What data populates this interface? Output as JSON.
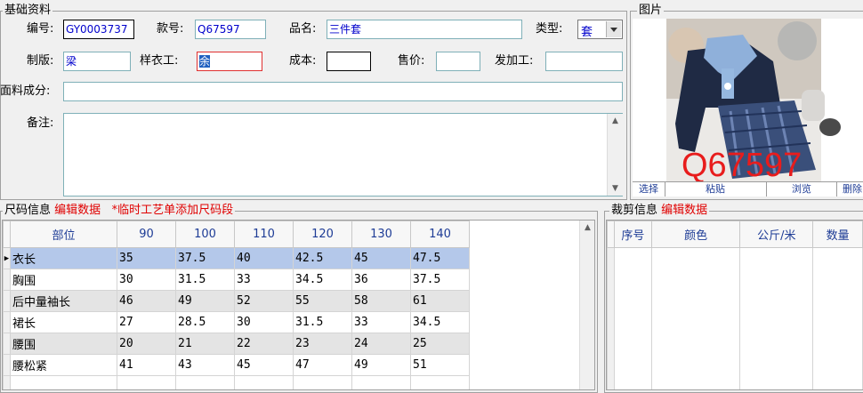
{
  "basic": {
    "title": "基础资料",
    "code_label": "编号:",
    "code_value": "GY0003737",
    "style_label": "款号:",
    "style_value": "Q67597",
    "name_label": "品名:",
    "name_value": "三件套",
    "type_label": "类型:",
    "type_value": "套",
    "maker_label": "制版:",
    "maker_value": "梁",
    "sample_label": "样衣工:",
    "sample_value": "余",
    "cost_label": "成本:",
    "cost_value": "",
    "price_label": "售价:",
    "price_value": "",
    "outsource_label": "发加工:",
    "outsource_value": "",
    "fabric_label": "面料成分:",
    "fabric_value": "",
    "note_label": "备注:",
    "note_value": ""
  },
  "picture": {
    "title": "图片",
    "watermark": "Q67597",
    "buttons": [
      "选择",
      "粘贴",
      "浏览",
      "删除"
    ]
  },
  "size": {
    "title": "尺码信息",
    "edit_link": "编辑数据",
    "hint": "*临时工艺单添加尺码段",
    "headers": [
      "部位",
      "90",
      "100",
      "110",
      "120",
      "130",
      "140"
    ],
    "rows": [
      [
        "衣长",
        "35",
        "37.5",
        "40",
        "42.5",
        "45",
        "47.5"
      ],
      [
        "胸围",
        "30",
        "31.5",
        "33",
        "34.5",
        "36",
        "37.5"
      ],
      [
        "后中量袖长",
        "46",
        "49",
        "52",
        "55",
        "58",
        "61"
      ],
      [
        "裙长",
        "27",
        "28.5",
        "30",
        "31.5",
        "33",
        "34.5"
      ],
      [
        "腰围",
        "20",
        "21",
        "22",
        "23",
        "24",
        "25"
      ],
      [
        "腰松紧",
        "41",
        "43",
        "45",
        "47",
        "49",
        "51"
      ]
    ],
    "selected_row": 0
  },
  "cutting": {
    "title": "裁剪信息",
    "edit_link": "编辑数据",
    "headers": [
      "序号",
      "颜色",
      "公斤/米",
      "数量"
    ]
  },
  "colors": {
    "label_blue": "#1e3c96",
    "value_blue": "#0000cc",
    "accent_red": "#e00000",
    "selected_row": "#b4c8ea"
  }
}
